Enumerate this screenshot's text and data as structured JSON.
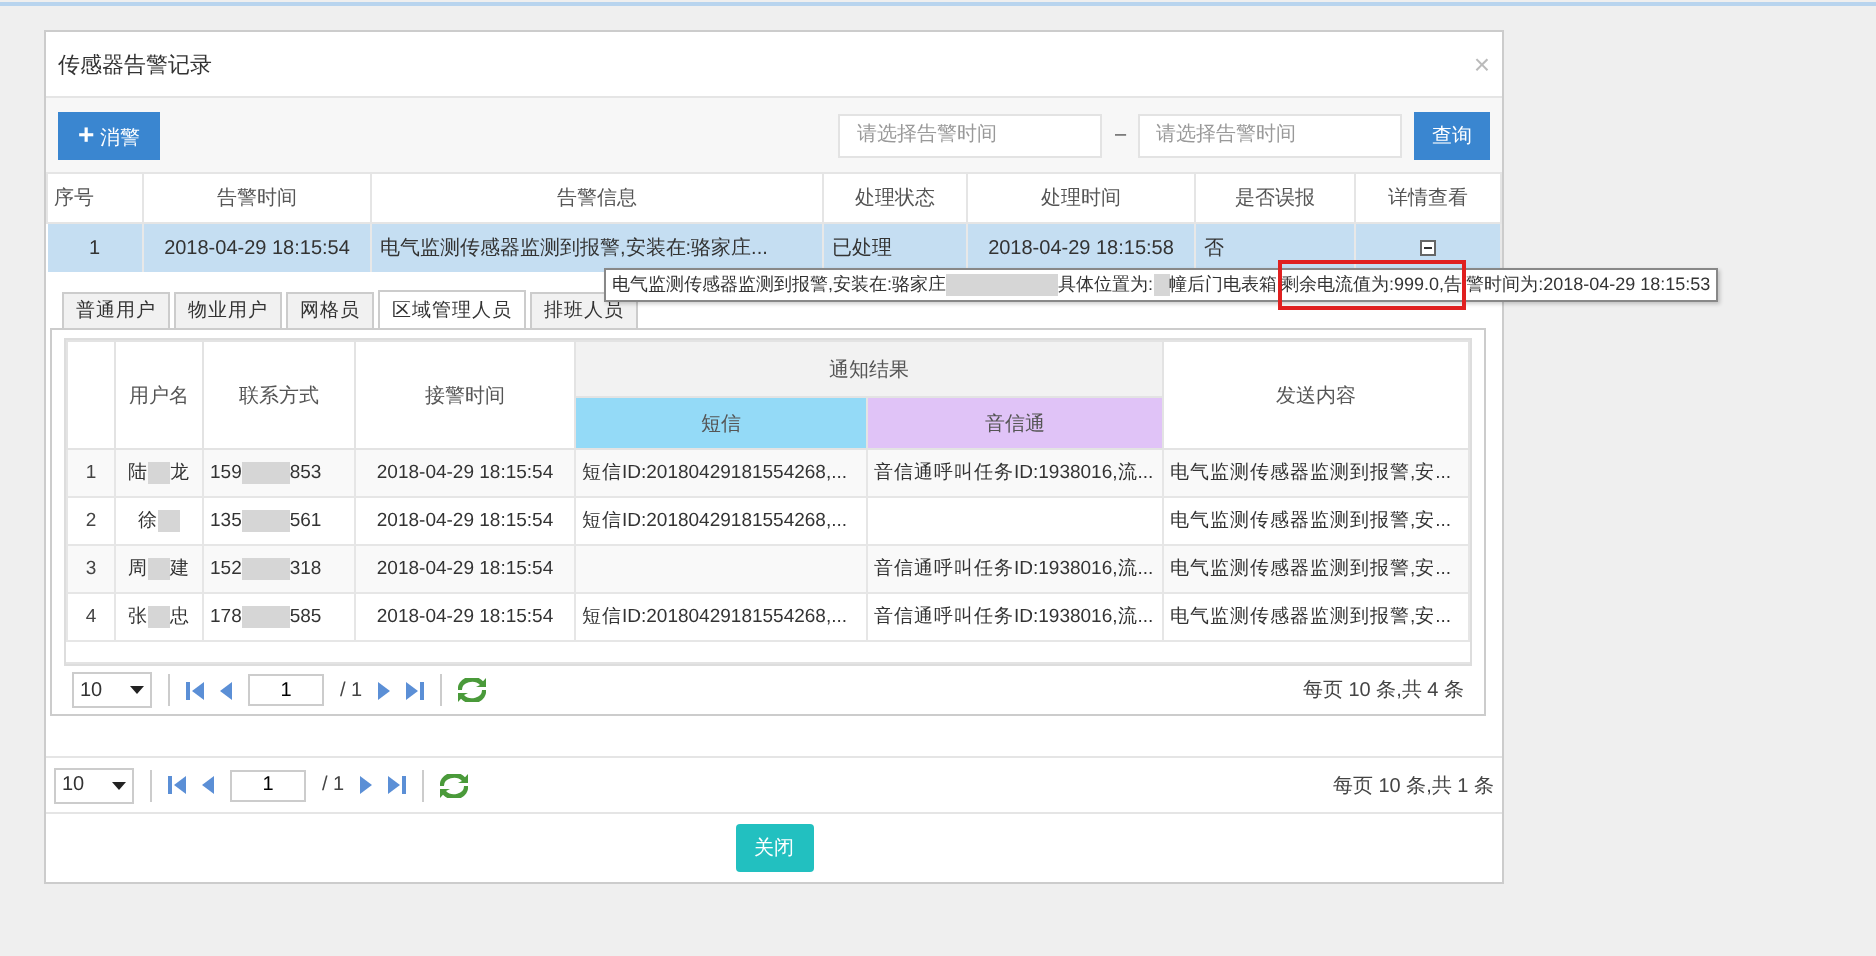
{
  "window": {
    "title": "传感器告警记录",
    "close": "×"
  },
  "toolbar": {
    "add_button": {
      "icon": "+",
      "label": "消警"
    },
    "start_field": {
      "placeholder": "请选择告警时间"
    },
    "separator": "–",
    "end_field": {
      "placeholder": "请选择告警时间"
    },
    "query_button": "查询"
  },
  "alarm_table": {
    "columns": [
      "序号",
      "告警时间",
      "告警信息",
      "处理状态",
      "处理时间",
      "是否误报",
      "详情查看"
    ],
    "rows": [
      {
        "cells": [
          "1",
          "2018-04-29 18:15:54",
          "电气监测传感器监测到报警,安装在:骆家庄...",
          "已处理",
          "2018-04-29 18:15:58",
          "否"
        ],
        "selected": true,
        "expanded": true
      }
    ]
  },
  "tooltip": {
    "segments": [
      {
        "text": "电气监测传感器监测到报警,安装在:骆家庄",
        "redacted_after": true,
        "highlighted": false
      },
      {
        "text": "具体位置为:",
        "redacted_after": true,
        "highlighted": false
      },
      {
        "text": "幢后门电表箱",
        "redacted_after": false,
        "highlighted": false
      },
      {
        "text": "剩余电流值为:999.0,告",
        "redacted_after": false,
        "highlighted": true
      },
      {
        "text": "警时间为:2018-04-29 18:15:53",
        "redacted_after": false,
        "highlighted": false
      }
    ]
  },
  "tabs": [
    {
      "label": "普通用户",
      "selected": false
    },
    {
      "label": "物业用户",
      "selected": false
    },
    {
      "label": "网格员",
      "selected": false
    },
    {
      "label": "区域管理人员",
      "selected": true
    },
    {
      "label": "排班人员",
      "selected": false
    }
  ],
  "notify_table": {
    "columns": [
      "用户名",
      "联系方式",
      "接警时间",
      "通知结果",
      "发送内容"
    ],
    "subcolumns": [
      {
        "label": "短信",
        "color": "#94daf7"
      },
      {
        "label": "音信通",
        "color": "#e0c3f7"
      }
    ],
    "rows": [
      {
        "index": "1",
        "name": [
          "陆",
          "龙"
        ],
        "phone": [
          "159",
          "853"
        ],
        "time": "2018-04-29 18:15:54",
        "sms": "短信ID:20180429181554268,...",
        "voice": "音信通呼叫任务ID:1938016,流...",
        "content": "电气监测传感器监测到报警,安..."
      },
      {
        "index": "2",
        "name": [
          "徐"
        ],
        "phone": [
          "135",
          "561"
        ],
        "time": "2018-04-29 18:15:54",
        "sms": "短信ID:20180429181554268,...",
        "content": "电气监测传感器监测到报警,安..."
      },
      {
        "index": "3",
        "name": [
          "周",
          "建"
        ],
        "phone": [
          "152",
          "318"
        ],
        "time": "2018-04-29 18:15:54",
        "voice": "音信通呼叫任务ID:1938016,流...",
        "content": "电气监测传感器监测到报警,安..."
      },
      {
        "index": "4",
        "name": [
          "张",
          "忠"
        ],
        "phone": [
          "178",
          "585"
        ],
        "time": "2018-04-29 18:15:54",
        "sms": "短信ID:20180429181554268,...",
        "voice": "音信通呼叫任务ID:1938016,流...",
        "content": "电气监测传感器监测到报警,安..."
      }
    ]
  },
  "inner_pager": {
    "page_size": "10",
    "page": "1",
    "total_pages": "/ 1",
    "summary": "每页 10 条,共 4 条"
  },
  "outer_pager": {
    "page_size": "10",
    "page": "1",
    "total_pages": "/ 1",
    "summary": "每页 10 条,共 1 条"
  },
  "footer": {
    "close_button": "关闭"
  }
}
